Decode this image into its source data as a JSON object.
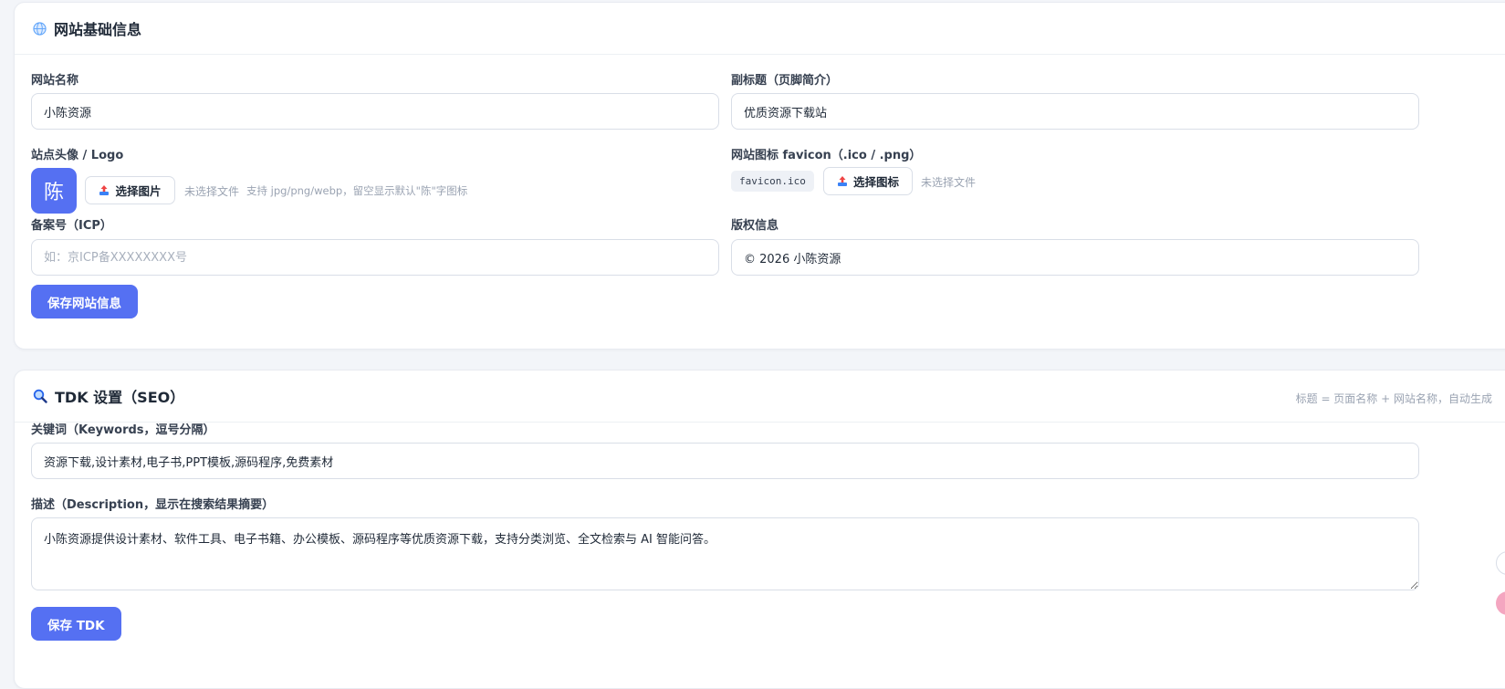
{
  "site_info": {
    "title": "网站基础信息",
    "icon": "globe-icon",
    "site_name": {
      "label": "网站名称",
      "value": "小陈资源"
    },
    "subtitle": {
      "label": "副标题（页脚简介）",
      "value": "优质资源下载站"
    },
    "logo": {
      "label": "站点头像 / Logo",
      "avatar_char": "陈",
      "button_label": "选择图片",
      "button_icon": "upload-icon",
      "file_status": "未选择文件",
      "hint": "支持 jpg/png/webp，留空显示默认\"陈\"字图标"
    },
    "favicon": {
      "label": "网站图标 favicon（.ico / .png）",
      "current_file": "favicon.ico",
      "button_label": "选择图标",
      "button_icon": "upload-icon",
      "file_status": "未选择文件"
    },
    "icp": {
      "label": "备案号（ICP）",
      "value": "",
      "placeholder": "如：京ICP备XXXXXXXX号"
    },
    "copyright": {
      "label": "版权信息",
      "value": "© 2026 小陈资源"
    },
    "save_label": "保存网站信息"
  },
  "tdk": {
    "title": "TDK 设置（SEO）",
    "icon": "search-icon",
    "header_hint": "标题 = 页面名称 + 网站名称，自动生成",
    "keywords": {
      "label": "关键词（Keywords，逗号分隔）",
      "value": "资源下载,设计素材,电子书,PPT模板,源码程序,免费素材"
    },
    "description": {
      "label": "描述（Description，显示在搜索结果摘要）",
      "value": "小陈资源提供设计素材、软件工具、电子书籍、办公模板、源码程序等优质资源下载，支持分类浏览、全文检索与 AI 智能问答。"
    },
    "save_label": "保存 TDK"
  },
  "colors": {
    "primary": "#5570f2",
    "background": "#f3f5f9",
    "border": "#d9dee7",
    "muted_text": "#9aa3b2"
  }
}
